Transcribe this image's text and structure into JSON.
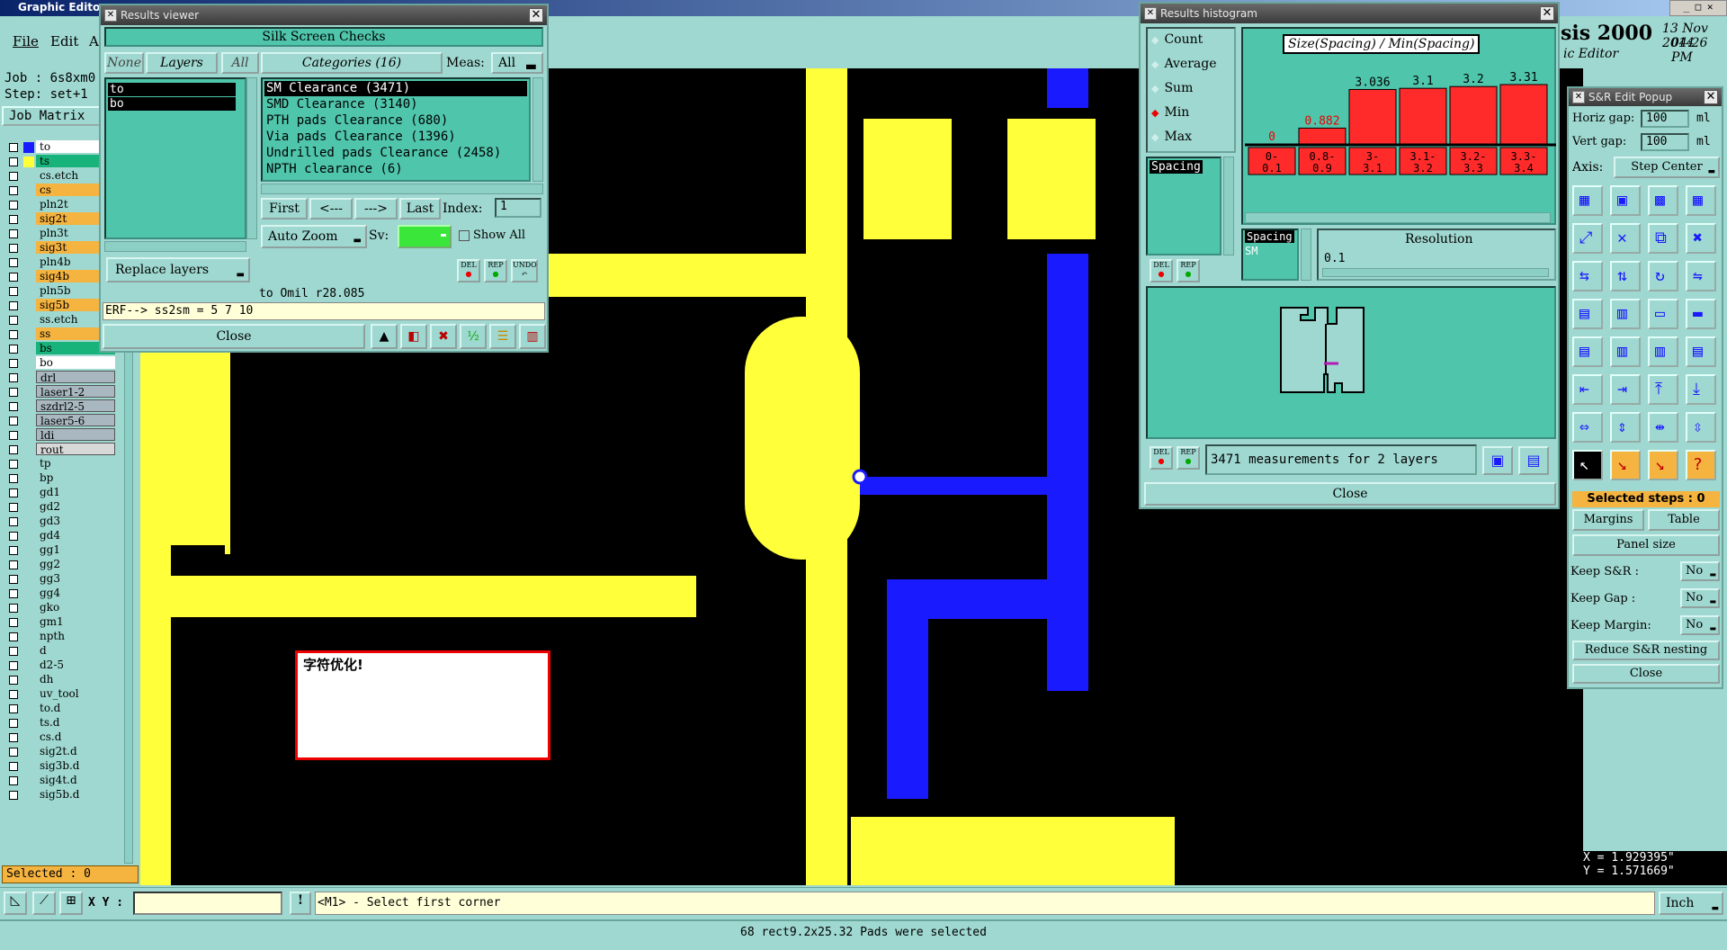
{
  "app": {
    "title": "Graphic Editor",
    "menu": [
      "File",
      "Edit",
      "A"
    ],
    "job": "Job : 6s8xm0",
    "step": "Step: set+1",
    "job_matrix": "Job Matrix",
    "brand": "sis 2000",
    "subtitle": "ic Editor",
    "date": "13 Nov 2014",
    "time": "04:26 PM"
  },
  "layers": [
    {
      "name": "to",
      "color": "#ffffff",
      "mark": "#1a1aff"
    },
    {
      "name": "ts",
      "color": "#17b37a",
      "mark": "#ffff3a"
    },
    {
      "name": "cs.etch",
      "color": "#9fd8d0"
    },
    {
      "name": "cs",
      "color": "#f5b340"
    },
    {
      "name": "pln2t",
      "color": "#9fd8d0"
    },
    {
      "name": "sig2t",
      "color": "#f5b340"
    },
    {
      "name": "pln3t",
      "color": "#9fd8d0"
    },
    {
      "name": "sig3t",
      "color": "#f5b340"
    },
    {
      "name": "pln4b",
      "color": "#9fd8d0"
    },
    {
      "name": "sig4b",
      "color": "#f5b340"
    },
    {
      "name": "pln5b",
      "color": "#9fd8d0"
    },
    {
      "name": "sig5b",
      "color": "#f5b340"
    },
    {
      "name": "ss.etch",
      "color": "#9fd8d0"
    },
    {
      "name": "ss",
      "color": "#f5b340"
    },
    {
      "name": "bs",
      "color": "#17b37a"
    },
    {
      "name": "bo",
      "color": "#ffffff"
    },
    {
      "name": "drl",
      "color": "#a9b8c0"
    },
    {
      "name": "laser1-2",
      "color": "#a9b8c0"
    },
    {
      "name": "szdrl2-5",
      "color": "#a9b8c0"
    },
    {
      "name": "laser5-6",
      "color": "#a9b8c0"
    },
    {
      "name": "ldi",
      "color": "#a9b8c0"
    },
    {
      "name": "rout",
      "color": "#d8d8d8"
    },
    {
      "name": "tp",
      "color": "#9fd8d0"
    },
    {
      "name": "bp",
      "color": "#9fd8d0"
    },
    {
      "name": "gd1",
      "color": "#9fd8d0"
    },
    {
      "name": "gd2",
      "color": "#9fd8d0"
    },
    {
      "name": "gd3",
      "color": "#9fd8d0"
    },
    {
      "name": "gd4",
      "color": "#9fd8d0"
    },
    {
      "name": "gg1",
      "color": "#9fd8d0"
    },
    {
      "name": "gg2",
      "color": "#9fd8d0"
    },
    {
      "name": "gg3",
      "color": "#9fd8d0"
    },
    {
      "name": "gg4",
      "color": "#9fd8d0"
    },
    {
      "name": "gko",
      "color": "#9fd8d0"
    },
    {
      "name": "gm1",
      "color": "#9fd8d0"
    },
    {
      "name": "npth",
      "color": "#9fd8d0"
    },
    {
      "name": "d",
      "color": "#9fd8d0"
    },
    {
      "name": "d2-5",
      "color": "#9fd8d0"
    },
    {
      "name": "dh",
      "color": "#9fd8d0"
    },
    {
      "name": "uv_tool",
      "color": "#9fd8d0"
    },
    {
      "name": "to.d",
      "color": "#9fd8d0"
    },
    {
      "name": "ts.d",
      "color": "#9fd8d0"
    },
    {
      "name": "cs.d",
      "color": "#9fd8d0"
    },
    {
      "name": "sig2t.d",
      "color": "#9fd8d0"
    },
    {
      "name": "sig3b.d",
      "color": "#9fd8d0"
    },
    {
      "name": "sig4t.d",
      "color": "#9fd8d0"
    },
    {
      "name": "sig5b.d",
      "color": "#9fd8d0"
    }
  ],
  "selected_count": "Selected : 0",
  "results_viewer": {
    "title": "Results viewer",
    "header": "Silk Screen Checks",
    "none": "None",
    "layers_tab": "Layers",
    "all": "All",
    "categories": "Categories (16)",
    "meas_label": "Meas:",
    "meas_value": "All",
    "layer_list": [
      "to",
      "bo"
    ],
    "category_list": [
      "SM Clearance (3471)",
      "SMD Clearance (3140)",
      "PTH pads Clearance (680)",
      "Via pads Clearance (1396)",
      "Undrilled pads Clearance (2458)",
      "NPTH clearance (6)"
    ],
    "first": "First",
    "prev": "<---",
    "next": "--->",
    "last": "Last",
    "index_label": "Index:",
    "index_value": "1",
    "auto_zoom": "Auto Zoom",
    "sv_label": "Sv:",
    "show_all": "Show All",
    "replace_layers": "Replace layers",
    "del": "DEL",
    "rep": "REP",
    "undo": "UNDO",
    "status": "to Omil  r28.085",
    "erf": "ERF--> ss2sm = 5 7 10",
    "close": "Close"
  },
  "histogram": {
    "title": "Results histogram",
    "options": [
      "Count",
      "Average",
      "Sum",
      "Min",
      "Max"
    ],
    "selected_option": "Min",
    "chart_title": "Size(Spacing) / Min(Spacing)",
    "bar_labels": [
      "0",
      "0.882",
      "3.036",
      "3.1",
      "3.2",
      "3.31"
    ],
    "bar_values": [
      0,
      0.882,
      3.036,
      3.1,
      3.2,
      3.31
    ],
    "bin_labels": [
      "0-\n0.1",
      "0.8-\n0.9",
      "3-\n3.1",
      "3.1-\n3.2",
      "3.2-\n3.3",
      "3.3-\n3.4"
    ],
    "spacing_item": "Spacing",
    "spacing_sm": "SM",
    "resolution_label": "Resolution",
    "resolution_value": "0.1",
    "summary": "3471 measurements for 2 layers",
    "close": "Close"
  },
  "sr_popup": {
    "title": "S&R Edit Popup",
    "horiz_gap_label": "Horiz gap:",
    "horiz_gap": "100",
    "vert_gap_label": "Vert  gap:",
    "vert_gap": "100",
    "unit": "ml",
    "axis_label": "Axis:",
    "axis_value": "Step Center",
    "selected_steps": "Selected steps : 0",
    "margins": "Margins",
    "table": "Table",
    "panel_size": "Panel size",
    "keep_sr": "Keep S&R   :",
    "keep_gap": "Keep Gap    :",
    "keep_margin": "Keep Margin:",
    "no": "No",
    "reduce": "Reduce S&R nesting",
    "close": "Close"
  },
  "annotation": "字符优化!",
  "coords": {
    "x": "X = 1.929395\"",
    "y": "Y = 1.571669\""
  },
  "bottom": {
    "xy_label": "X Y :",
    "prompt": "<M1> - Select first corner",
    "units": "Inch",
    "status": "68 rect9.2x25.32 Pads were selected"
  }
}
